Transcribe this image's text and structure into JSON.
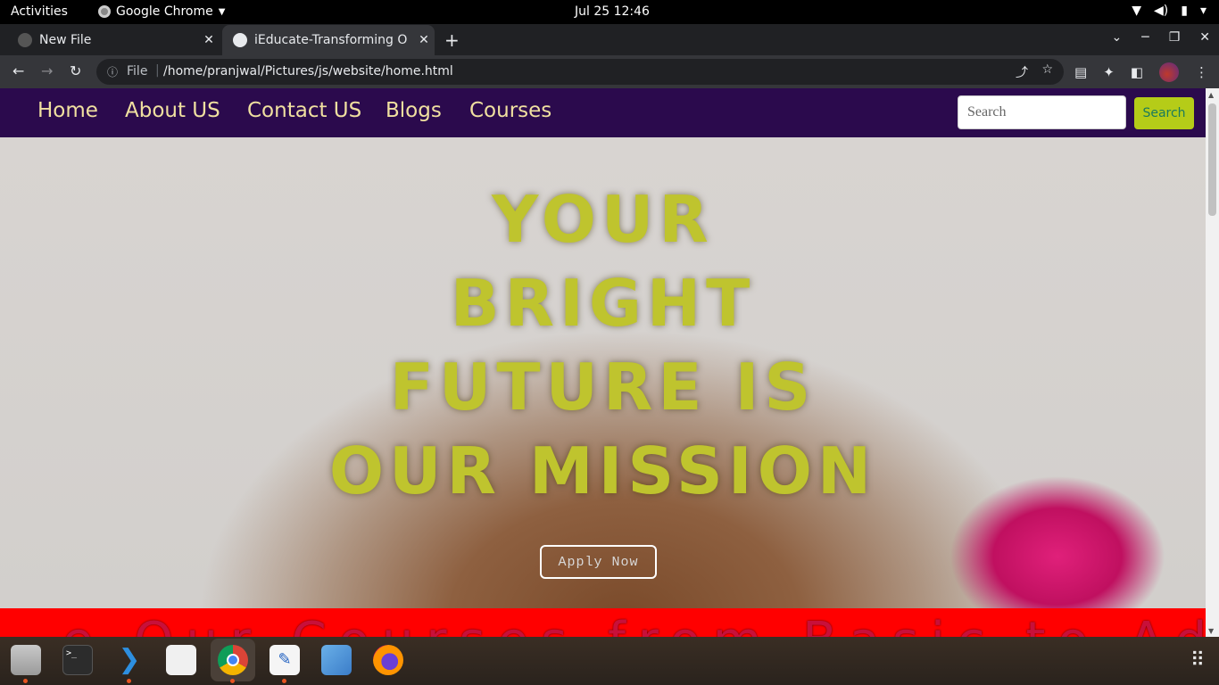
{
  "system": {
    "activities": "Activities",
    "app_name": "Google Chrome",
    "clock": "Jul 25  12:46"
  },
  "browser": {
    "tabs": [
      {
        "title": "New File",
        "active": false
      },
      {
        "title": "iEducate-Transforming O",
        "active": true
      }
    ],
    "new_tab": "+",
    "address": {
      "scheme_label": "File",
      "url": "/home/pranjwal/Pictures/js/website/home.html"
    }
  },
  "site": {
    "nav": [
      "Home",
      "About US",
      "Contact US",
      "Blogs",
      "Courses"
    ],
    "search": {
      "placeholder": "Search",
      "button_label": "Search"
    },
    "hero": {
      "heading_lines": [
        "YOUR",
        "BRIGHT",
        "FUTURE IS",
        "OUR MISSION"
      ],
      "cta_label": "Apply Now"
    },
    "marquee_partial_text": "e Our Courses from Basic to Advan"
  },
  "colors": {
    "nav_bg": "#2b0a4d",
    "nav_text": "#f0e0a0",
    "heading": "#bfc42e",
    "search_button": "#b5cc18",
    "marquee_bg": "#ff0000"
  },
  "dock": {
    "apps": [
      "files-icon",
      "terminal-icon",
      "vscode-icon",
      "document-viewer-icon",
      "chrome-icon",
      "text-editor-icon",
      "cube-app-icon",
      "firefox-icon"
    ],
    "show_apps_icon": "app-grid-icon"
  }
}
